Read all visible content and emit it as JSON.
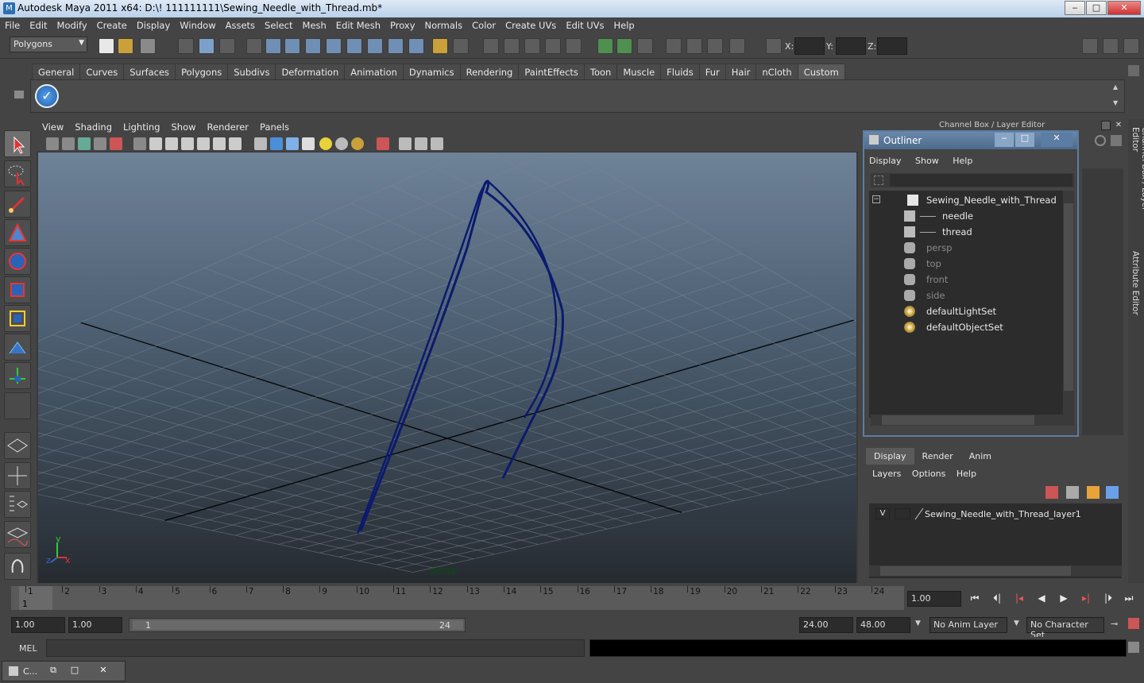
{
  "window": {
    "title": "Autodesk Maya 2011 x64: D:\\! 111111111\\Sewing_Needle_with_Thread.mb*",
    "min": "‒",
    "max": "□",
    "close": "✕"
  },
  "menubar": [
    "File",
    "Edit",
    "Modify",
    "Create",
    "Display",
    "Window",
    "Assets",
    "Select",
    "Mesh",
    "Edit Mesh",
    "Proxy",
    "Normals",
    "Color",
    "Create UVs",
    "Edit UVs",
    "Help"
  ],
  "status": {
    "mode": "Polygons",
    "x_label": "X:",
    "y_label": "Y:",
    "z_label": "Z:"
  },
  "shelf": {
    "tabs": [
      "General",
      "Curves",
      "Surfaces",
      "Polygons",
      "Subdivs",
      "Deformation",
      "Animation",
      "Dynamics",
      "Rendering",
      "PaintEffects",
      "Toon",
      "Muscle",
      "Fluids",
      "Fur",
      "Hair",
      "nCloth",
      "Custom"
    ],
    "active": "Custom"
  },
  "viewport": {
    "menu": [
      "View",
      "Shading",
      "Lighting",
      "Show",
      "Renderer",
      "Panels"
    ],
    "camera_label": "persp",
    "axis": {
      "x": "x",
      "y": "y",
      "z": "z"
    },
    "thread_color": "#0c1a6e"
  },
  "channelbox_title": "Channel Box / Layer Editor",
  "outliner": {
    "title": "Outliner",
    "menu": [
      "Display",
      "Show",
      "Help"
    ],
    "items": [
      {
        "label": "Sewing_Needle_with_Thread",
        "dim": false,
        "indent": 0,
        "icon": "group-icon"
      },
      {
        "label": "needle",
        "dim": false,
        "indent": 1,
        "icon": "mesh-icon"
      },
      {
        "label": "thread",
        "dim": false,
        "indent": 1,
        "icon": "mesh-icon"
      },
      {
        "label": "persp",
        "dim": true,
        "indent": 0,
        "icon": "camera-icon"
      },
      {
        "label": "top",
        "dim": true,
        "indent": 0,
        "icon": "camera-icon"
      },
      {
        "label": "front",
        "dim": true,
        "indent": 0,
        "icon": "camera-icon"
      },
      {
        "label": "side",
        "dim": true,
        "indent": 0,
        "icon": "camera-icon"
      },
      {
        "label": "defaultLightSet",
        "dim": false,
        "indent": 0,
        "icon": "set-icon"
      },
      {
        "label": "defaultObjectSet",
        "dim": false,
        "indent": 0,
        "icon": "set-icon"
      }
    ]
  },
  "layers": {
    "tabs": [
      "Display",
      "Render",
      "Anim"
    ],
    "menu": [
      "Layers",
      "Options",
      "Help"
    ],
    "layer_vis": "V",
    "layer_name": "Sewing_Needle_with_Thread_layer1"
  },
  "side_tabs": [
    "Channel Box / Layer Editor",
    "Attribute Editor"
  ],
  "timeline": {
    "ticks": [
      "1",
      "2",
      "3",
      "4",
      "5",
      "6",
      "7",
      "8",
      "9",
      "10",
      "11",
      "12",
      "13",
      "14",
      "15",
      "16",
      "17",
      "18",
      "19",
      "20",
      "21",
      "22",
      "23",
      "24"
    ],
    "current_frame_marker": "1",
    "current_time": "1.00"
  },
  "range": {
    "start": "1.00",
    "anim_start": "1.00",
    "slider_start": "1",
    "slider_end": "24",
    "end": "24.00",
    "anim_end": "48.00",
    "anim_layer": "No Anim Layer",
    "char_set": "No Character Set"
  },
  "cmdline": {
    "label": "MEL"
  },
  "taskbar": {
    "label": "C..."
  }
}
